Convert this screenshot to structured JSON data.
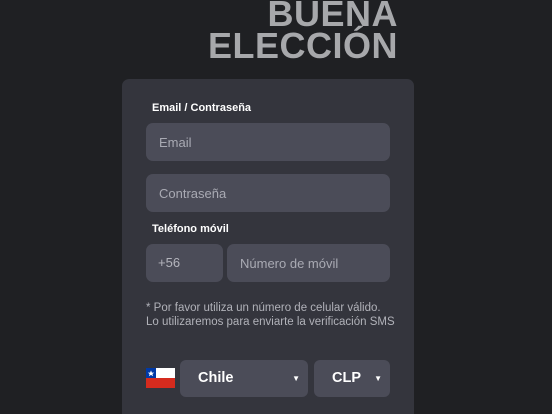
{
  "headline": {
    "line1": "BUENA",
    "line2": "ELECCIÓN"
  },
  "form": {
    "email_password_label": "Email / Contraseña",
    "email_placeholder": "Email",
    "password_placeholder": "Contraseña",
    "phone_label": "Teléfono móvil",
    "phone_prefix": "+56",
    "phone_placeholder": "Número de móvil",
    "note": "* Por favor utiliza un número de celular válido. Lo utilizaremos para enviarte la verificación SMS",
    "country": {
      "selected": "Chile",
      "flag_icon": "chile-flag-icon"
    },
    "currency": {
      "selected": "CLP"
    }
  },
  "colors": {
    "background": "#1f2023",
    "card": "#34353d",
    "field": "#4b4c58",
    "headline": "#a7a8ab"
  }
}
